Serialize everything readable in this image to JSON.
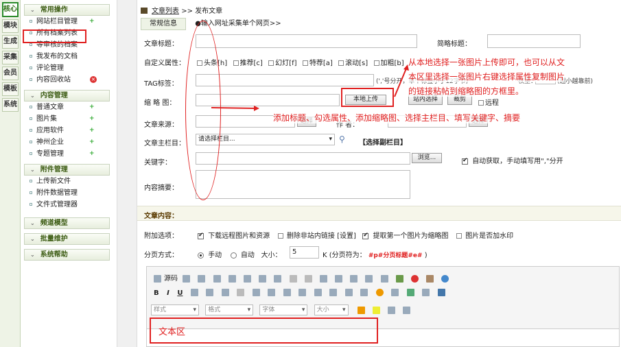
{
  "vtabs": [
    "核心",
    "模块",
    "生成",
    "采集",
    "会员",
    "模板",
    "系统"
  ],
  "sidebar": {
    "groups": [
      {
        "title": "常用操作",
        "items": [
          "网站栏目管理",
          "所有档案列表",
          "等审核的档案",
          "我发布的文档",
          "评论管理",
          "内容回收站"
        ]
      },
      {
        "title": "内容管理",
        "items": [
          "普通文章",
          "图片集",
          "应用软件",
          "神州企业",
          "专题管理"
        ]
      },
      {
        "title": "附件管理",
        "items": [
          "上传新文件",
          "附件数据管理",
          "文件式管理器"
        ]
      },
      {
        "title": "频道模型",
        "items": []
      },
      {
        "title": "批量维护",
        "items": []
      },
      {
        "title": "系统帮助",
        "items": []
      }
    ]
  },
  "crumb": {
    "link": "文章列表",
    "rest": ">> 发布文章"
  },
  "tabs": {
    "t1": "常规信息",
    "t2": "●输入网址采集单个网页>>"
  },
  "form": {
    "title_label": "文章标题：",
    "short_title_label": "简略标题：",
    "attr_label": "自定义属性：",
    "attrs": [
      "头条[h]",
      "推荐[c]",
      "幻灯[f]",
      "特荐[a]",
      "滚动[s]",
      "加粗[b]"
    ],
    "tag_label": "TAG标签：",
    "tag_hint": "(','号分开，单个标签小于12字节)",
    "weight_label": "权重：",
    "weight_hint": "(越小越靠前)",
    "thumb_label": "缩 略 图：",
    "upload_btn": "本地上传",
    "site_select_btn": "站内选择",
    "crop_btn": "裁剪",
    "remote_label": "远程",
    "source_label": "文章来源：",
    "select_btn": "选择",
    "author_label": "作 者：",
    "select_btn2": "选择",
    "column_label": "文章主栏目：",
    "column_value": "请选择栏目...",
    "sub_column": "【选择副栏目】",
    "keyword_label": "关键字：",
    "browse_btn": "浏览...",
    "auto_keyword": "自动获取，手动填写用\",\"分开",
    "summary_label": "内容摘要："
  },
  "content_section": "文章内容：",
  "options": {
    "label": "附加选项：",
    "o1": "下载远程图片和资源",
    "o2": "删除非站内链接 [设置]",
    "o3": "提取第一个图片为缩略图",
    "o4": "图片是否加水印"
  },
  "paging": {
    "label": "分页方式：",
    "manual": "手动",
    "auto": "自动",
    "size_label": "大小：",
    "size_value": "5",
    "k_label": "K (分页符为：",
    "marker": "#p#分页标题#e#",
    "close": ")"
  },
  "editor": {
    "source": "源码",
    "style": "样式",
    "format": "格式",
    "font": "字体",
    "size": "大小",
    "text_area": "文本区"
  },
  "annotations": {
    "a1": "从本地选择一张图片上传即可，也可以从文",
    "a2": "本区里选择一张图片右键选择属性复制图片",
    "a3": "的链接粘帖到缩略图的方框里。",
    "a4": "添加标题、勾选属性、添加缩略图、选择主栏目、填写关键字、摘要"
  },
  "colors": {
    "accent": "#e02020",
    "green": "#2b8a2b"
  }
}
